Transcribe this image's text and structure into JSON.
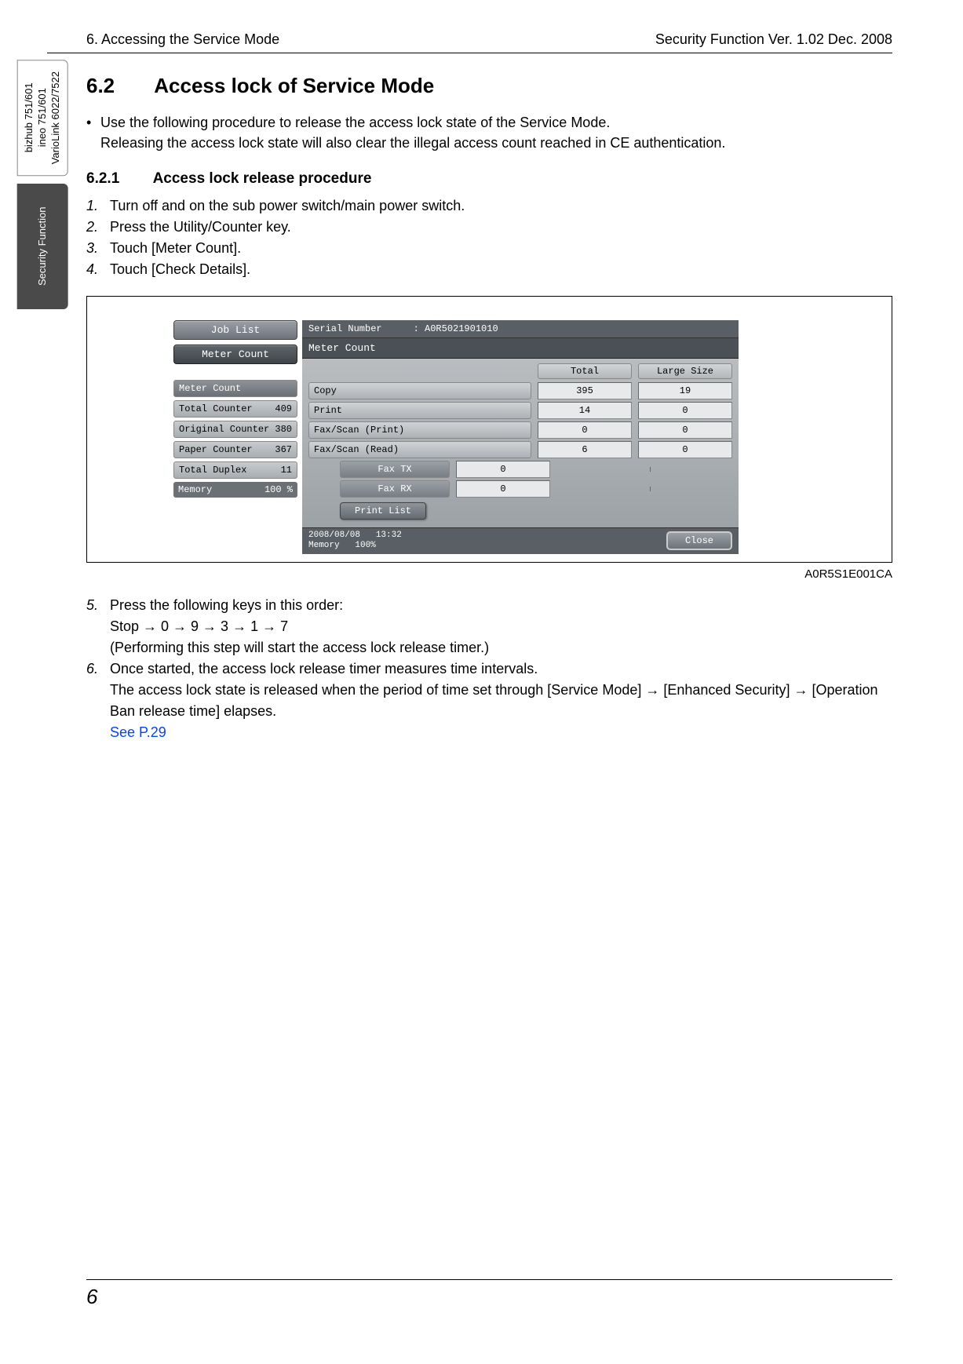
{
  "header": {
    "left": "6. Accessing the Service Mode",
    "right": "Security Function Ver. 1.02 Dec. 2008"
  },
  "side_tabs": {
    "models": "bizhub 751/601\nineo 751/601\nVarioLink 6022/7522",
    "security": "Security Function"
  },
  "section": {
    "num": "6.2",
    "title": "Access lock of Service Mode"
  },
  "intro": {
    "line1": "Use the following procedure to release the access lock state of the Service Mode.",
    "line2": "Releasing the access lock state will also clear the illegal access count reached in CE authentication."
  },
  "subsection": {
    "num": "6.2.1",
    "title": "Access lock release procedure"
  },
  "steps_a": [
    {
      "n": "1.",
      "t": "Turn off and on the sub power switch/main power switch."
    },
    {
      "n": "2.",
      "t": "Press the Utility/Counter key."
    },
    {
      "n": "3.",
      "t": "Touch [Meter Count]."
    },
    {
      "n": "4.",
      "t": "Touch [Check Details]."
    }
  ],
  "figure_id": "A0R5S1E001CA",
  "ui": {
    "left_buttons": {
      "job_list": "Job List",
      "meter_count": "Meter Count"
    },
    "left_info": [
      {
        "label": "Meter Count",
        "val": "",
        "selected": true
      },
      {
        "label": "Total Counter",
        "val": "409"
      },
      {
        "label": "Original Counter",
        "val": "380"
      },
      {
        "label": "Paper Counter",
        "val": "367"
      },
      {
        "label": "Total Duplex",
        "val": "11"
      }
    ],
    "memory": {
      "label": "Memory",
      "val": "100 %"
    },
    "serial": {
      "label": "Serial Number",
      "value": ": A0R5021901010"
    },
    "panel_title": "Meter Count",
    "col_heads": {
      "total": "Total",
      "large": "Large Size"
    },
    "rows": [
      {
        "label": "Copy",
        "total": "395",
        "large": "19",
        "indent": false
      },
      {
        "label": "Print",
        "total": "14",
        "large": "0",
        "indent": false
      },
      {
        "label": "Fax/Scan (Print)",
        "total": "0",
        "large": "0",
        "indent": false
      },
      {
        "label": "Fax/Scan (Read)",
        "total": "6",
        "large": "0",
        "indent": false
      },
      {
        "label": "Fax TX",
        "total": "0",
        "large": "",
        "indent": true
      },
      {
        "label": "Fax RX",
        "total": "0",
        "large": "",
        "indent": true
      }
    ],
    "print_list": "Print List",
    "footer": {
      "date": "2008/08/08",
      "time": "13:32",
      "mem_label": "Memory",
      "mem_val": "100%"
    },
    "close": "Close"
  },
  "steps_b": {
    "s5": {
      "n": "5.",
      "line1": "Press the following keys in this order:",
      "line2": "Stop → 0 → 9 → 3 → 1 → 7",
      "line3": "(Performing this step will start the access lock release timer.)"
    },
    "s6": {
      "n": "6.",
      "line1": "Once started, the access lock release timer measures time intervals.",
      "line2": "The access lock state is released when the period of time set through [Service Mode] → [Enhanced Security] → [Operation Ban release time] elapses.",
      "link": "See P.29"
    }
  },
  "page_number": "6"
}
